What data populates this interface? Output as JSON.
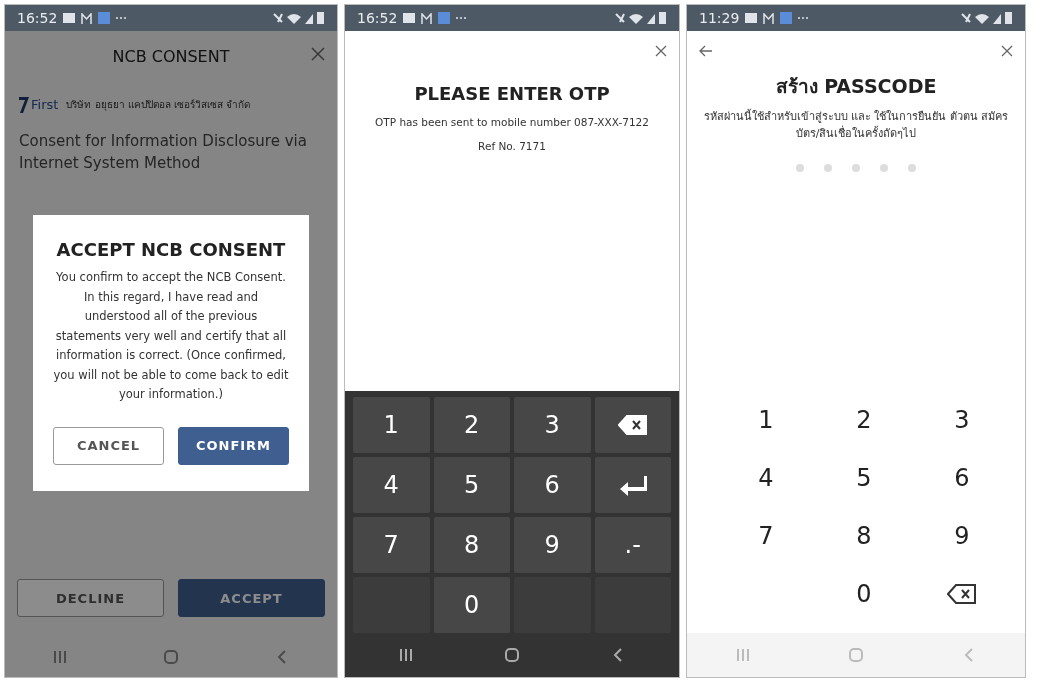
{
  "screens": [
    {
      "kind": "consent",
      "status_bar": {
        "time": "16:52"
      },
      "title": "NCB CONSENT",
      "company_logo": "First",
      "company_name": "บริษัท อยุธยา แคปปิตอล เซอร์วิสเซส จำกัด",
      "heading": "Consent for Information Disclosure via Internet System Method",
      "buttons": [
        {
          "label": "DECLINE",
          "kind": "outline"
        },
        {
          "label": "ACCEPT",
          "kind": "filled"
        }
      ],
      "dialog": {
        "title": "ACCEPT NCB CONSENT",
        "message": "You confirm to accept the NCB Consent. In this regard, I have read and understood all of the previous statements very well and certify that all information is correct. (Once confirmed, you will not be able to come back to edit your information.)",
        "buttons": [
          {
            "label": "CANCEL",
            "kind": "outline"
          },
          {
            "label": "CONFIRM",
            "kind": "filled"
          }
        ]
      }
    },
    {
      "kind": "otp",
      "status_bar": {
        "time": "16:52"
      },
      "title": "PLEASE ENTER OTP",
      "message": "OTP has been sent to mobile number 087-XXX-7122",
      "reference": "Ref No. 7171",
      "keys": [
        {
          "kind": "digit",
          "label": "1"
        },
        {
          "kind": "digit",
          "label": "2"
        },
        {
          "kind": "digit",
          "label": "3"
        },
        {
          "kind": "backspace"
        },
        {
          "kind": "digit",
          "label": "4"
        },
        {
          "kind": "digit",
          "label": "5"
        },
        {
          "kind": "digit",
          "label": "6"
        },
        {
          "kind": "enter"
        },
        {
          "kind": "digit",
          "label": "7"
        },
        {
          "kind": "digit",
          "label": "8"
        },
        {
          "kind": "digit",
          "label": "9"
        },
        {
          "kind": "digit",
          "label": ".-"
        },
        {
          "kind": "blank"
        },
        {
          "kind": "digit",
          "label": "0"
        },
        {
          "kind": "blank"
        },
        {
          "kind": "blank"
        }
      ]
    },
    {
      "kind": "passcode",
      "status_bar": {
        "time": "11:29"
      },
      "title": "สร้าง PASSCODE",
      "message": "รหัสผ่านนี้ใช้สำหรับเข้าสู่ระบบ และ ใช้ในการยืนยัน ตัวตน สมัครบัตร/สินเชื่อในครั้งถัดๆไป",
      "keys": [
        {
          "kind": "digit",
          "label": "1"
        },
        {
          "kind": "digit",
          "label": "2"
        },
        {
          "kind": "digit",
          "label": "3"
        },
        {
          "kind": "digit",
          "label": "4"
        },
        {
          "kind": "digit",
          "label": "5"
        },
        {
          "kind": "digit",
          "label": "6"
        },
        {
          "kind": "digit",
          "label": "7"
        },
        {
          "kind": "digit",
          "label": "8"
        },
        {
          "kind": "digit",
          "label": "9"
        },
        {
          "kind": "blank"
        },
        {
          "kind": "digit",
          "label": "0"
        },
        {
          "kind": "backspace"
        }
      ]
    }
  ]
}
